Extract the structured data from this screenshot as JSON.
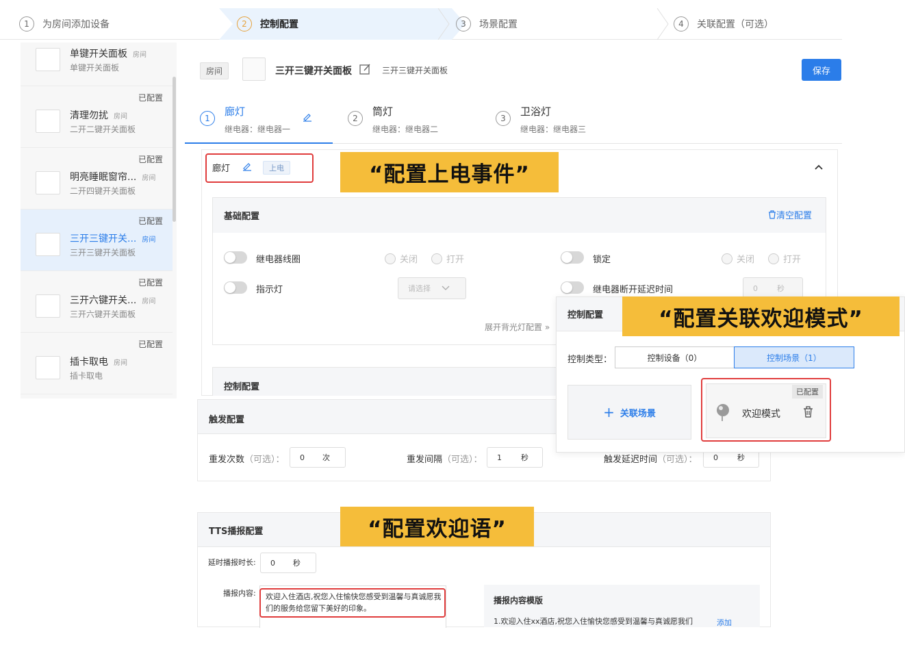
{
  "steps": [
    {
      "num": "1",
      "label": "为房间添加设备"
    },
    {
      "num": "2",
      "label": "控制配置"
    },
    {
      "num": "3",
      "label": "场景配置"
    },
    {
      "num": "4",
      "label": "关联配置（可选）"
    }
  ],
  "sidebar": {
    "items": [
      {
        "tag": "",
        "title": "单键开关面板",
        "room": "房间",
        "sub": "单键开关面板"
      },
      {
        "tag": "已配置",
        "title": "清理勿扰",
        "room": "房间",
        "sub": "二开二键开关面板"
      },
      {
        "tag": "已配置",
        "title": "明亮睡眠窗帘...",
        "room": "房间",
        "sub": "二开四键开关面板"
      },
      {
        "tag": "已配置",
        "title": "三开三键开关...",
        "room": "房间",
        "sub": "三开三键开关面板"
      },
      {
        "tag": "已配置",
        "title": "三开六键开关...",
        "room": "房间",
        "sub": "三开六键开关面板"
      },
      {
        "tag": "已配置",
        "title": "插卡取电",
        "room": "房间",
        "sub": "插卡取电"
      }
    ]
  },
  "header": {
    "room_tag": "房间",
    "device_name": "三开三键开关面板",
    "device_sub": "三开三键开关面板",
    "save": "保存"
  },
  "channels": [
    {
      "num": "1",
      "title": "廊灯",
      "sub": "继电器：继电器一"
    },
    {
      "num": "2",
      "title": "筒灯",
      "sub": "继电器：继电器二"
    },
    {
      "num": "3",
      "title": "卫浴灯",
      "sub": "继电器：继电器三"
    }
  ],
  "panel": {
    "name": "廊灯",
    "badge": "上电",
    "basic_title": "基础配置",
    "clear": "清空配置",
    "relay_coil": "继电器线圈",
    "off": "关闭",
    "on": "打开",
    "lock": "锁定",
    "indicator": "指示灯",
    "select_placeholder": "请选择",
    "relay_delay": "继电器断开延迟时间",
    "delay_value": "0",
    "unit_sec": "秒",
    "expand_backlight": "展开背光灯配置",
    "control_title": "控制配置"
  },
  "overlay": {
    "title": "控制配置",
    "type_label": "控制类型：",
    "seg_device": "控制设备（0）",
    "seg_scene": "控制场景（1）",
    "add_scene": "关联场景",
    "scene_tag": "已配置",
    "scene_name": "欢迎模式"
  },
  "trigger": {
    "title": "触发配置",
    "repeat_label": "重发次数",
    "repeat_opt": "（可选）：",
    "repeat_val": "0",
    "repeat_unit": "次",
    "interval_label": "重发间隔",
    "interval_opt": "（可选）：",
    "interval_val": "1",
    "interval_unit": "秒",
    "delay_label": "触发延迟时间",
    "delay_opt": "（可选）：",
    "delay_val": "0",
    "delay_unit": "秒"
  },
  "tts": {
    "title": "TTS播报配置",
    "delay_label": "延时播报时长:",
    "delay_val": "0",
    "delay_unit": "秒",
    "content_label": "播报内容:",
    "content": "欢迎入住酒店,祝您入住愉快您感受到温馨与真诚愿我们的服务给您留下美好的印象。",
    "template_title": "播报内容模版",
    "template_1": "1.欢迎入住xx酒店,祝您入住愉快您感受到温馨与真诚愿我们",
    "template_add": "添加"
  },
  "callouts": {
    "power": "“配置上电事件”",
    "welcome_mode": "“配置关联欢迎模式”",
    "greeting": "“配置欢迎语”"
  },
  "colors": {
    "primary": "#2b7de9",
    "callout": "#f5bd3a",
    "highlight": "#e03c3c",
    "step_active": "#e6a23c"
  }
}
